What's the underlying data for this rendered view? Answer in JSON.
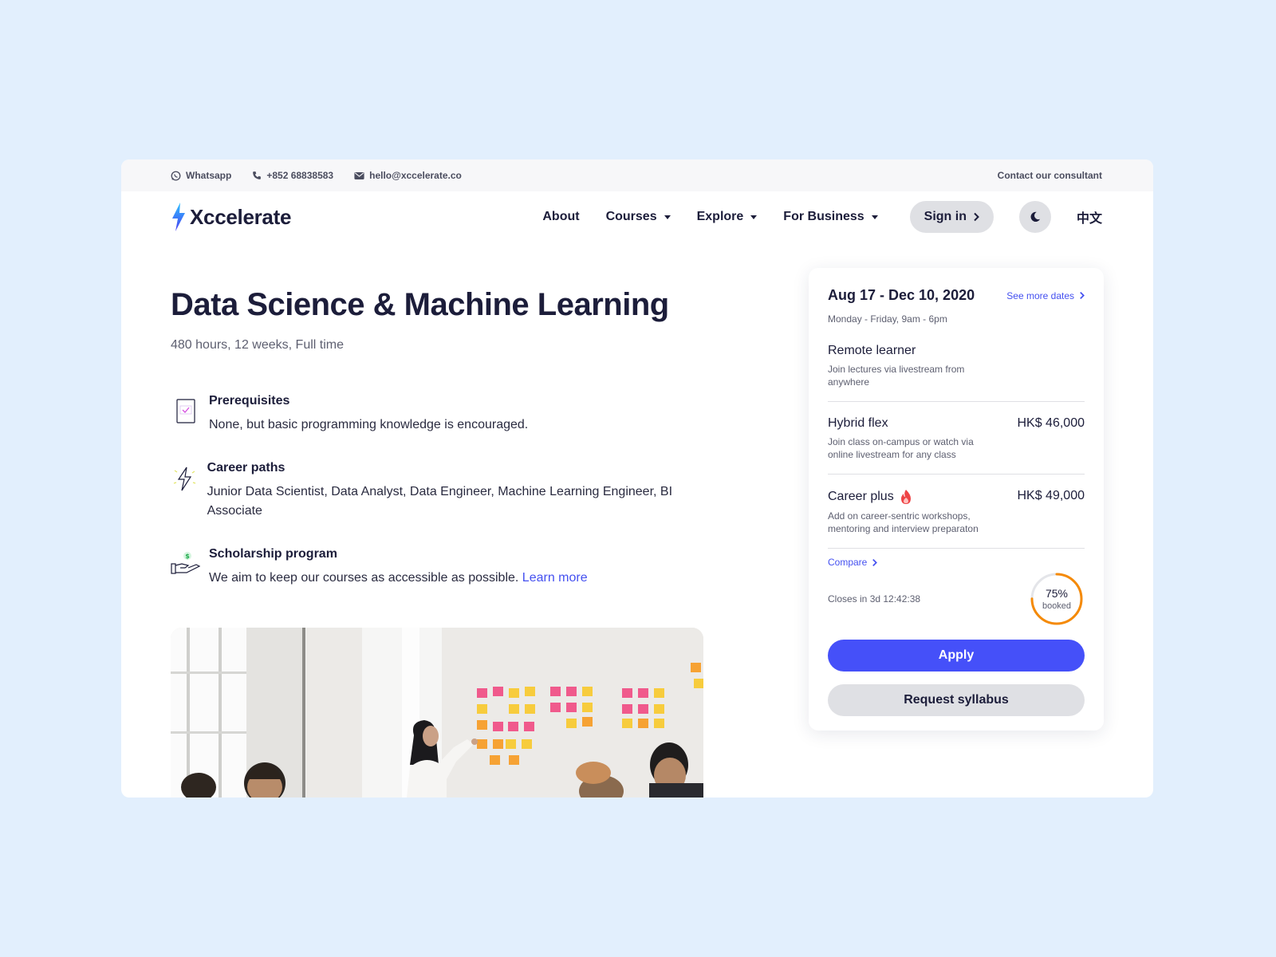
{
  "topbar": {
    "whatsapp": "Whatsapp",
    "phone": "+852 68838583",
    "email": "hello@xccelerate.co",
    "contact": "Contact our consultant"
  },
  "nav": {
    "logo": "Xccelerate",
    "about": "About",
    "courses": "Courses",
    "explore": "Explore",
    "business": "For Business",
    "signin": "Sign in",
    "lang": "中文"
  },
  "course": {
    "title": "Data Science & Machine Learning",
    "subtitle": "480 hours, 12 weeks, Full time",
    "features": [
      {
        "title": "Prerequisites",
        "desc": "None, but basic programming knowledge is encouraged.",
        "icon": "checklist-icon"
      },
      {
        "title": "Career paths",
        "desc": "Junior Data Scientist, Data Analyst, Data Engineer, Machine Learning Engineer, BI Associate",
        "icon": "lightning-icon"
      },
      {
        "title": "Scholarship program",
        "desc": "We aim to keep our courses as accessible as possible.",
        "link": "Learn more",
        "icon": "hand-money-icon"
      }
    ]
  },
  "card": {
    "date": "Aug 17 - Dec 10, 2020",
    "see_more": "See more dates",
    "schedule": "Monday - Friday, 9am - 6pm",
    "plans": [
      {
        "name": "Remote learner",
        "desc": "Join lectures via livestream from anywhere",
        "price": ""
      },
      {
        "name": "Hybrid flex",
        "desc": "Join class on-campus or watch via online livestream for any class",
        "price": "HK$ 46,000"
      },
      {
        "name": "Career plus",
        "desc": "Add on career-sentric workshops, mentoring and interview preparaton",
        "price": "HK$ 49,000"
      }
    ],
    "compare": "Compare",
    "closes": "Closes in 3d 12:42:38",
    "booked_pct": "75%",
    "booked_fraction": 0.75,
    "booked_label": "booked",
    "apply": "Apply",
    "syllabus": "Request syllabus"
  },
  "colors": {
    "accent": "#4550f9",
    "ring": "#f58a07",
    "background": "#e2effd"
  }
}
